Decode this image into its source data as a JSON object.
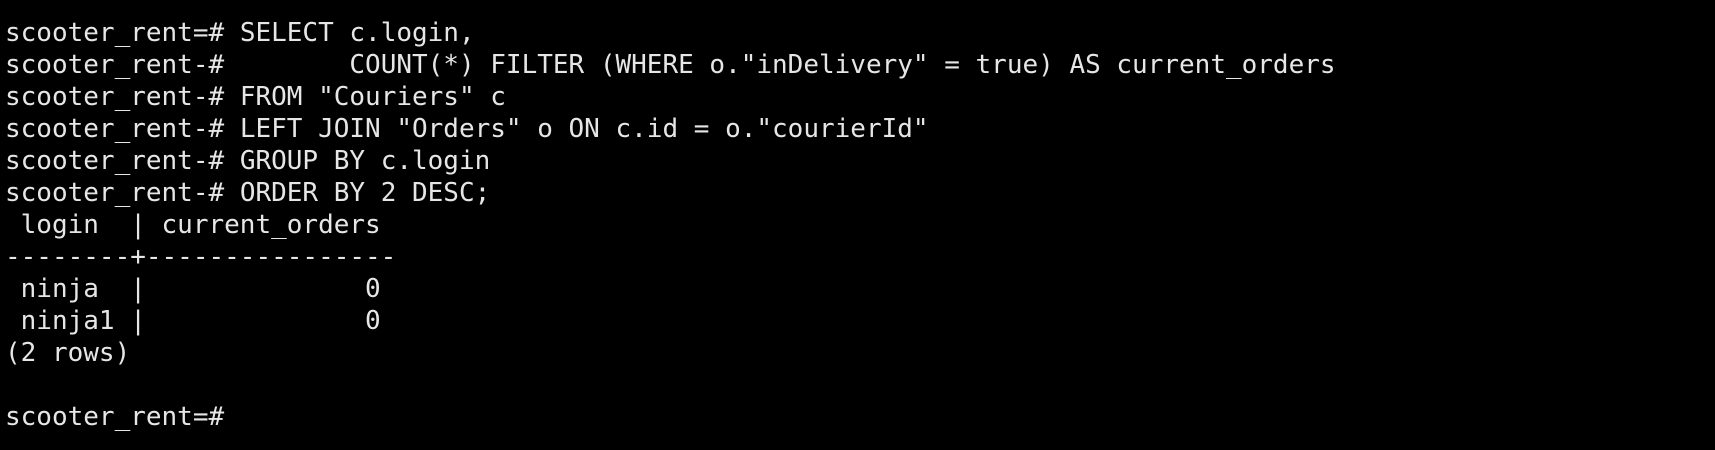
{
  "terminal": {
    "colors": {
      "background": "#000000",
      "foreground": "#e6e6e6"
    },
    "query_lines": [
      {
        "prompt": "scooter_rent=# ",
        "text": "SELECT c.login,"
      },
      {
        "prompt": "scooter_rent-# ",
        "text": "       COUNT(*) FILTER (WHERE o.\"inDelivery\" = true) AS current_orders"
      },
      {
        "prompt": "scooter_rent-# ",
        "text": "FROM \"Couriers\" c"
      },
      {
        "prompt": "scooter_rent-# ",
        "text": "LEFT JOIN \"Orders\" o ON c.id = o.\"courierId\""
      },
      {
        "prompt": "scooter_rent-# ",
        "text": "GROUP BY c.login"
      },
      {
        "prompt": "scooter_rent-# ",
        "text": "ORDER BY 2 DESC;"
      }
    ],
    "result": {
      "header": " login  | current_orders",
      "separator": "--------+----------------",
      "rows": [
        " ninja  |              0",
        " ninja1 |              0"
      ],
      "footer": "(2 rows)"
    },
    "final_prompt": "scooter_rent=# "
  }
}
